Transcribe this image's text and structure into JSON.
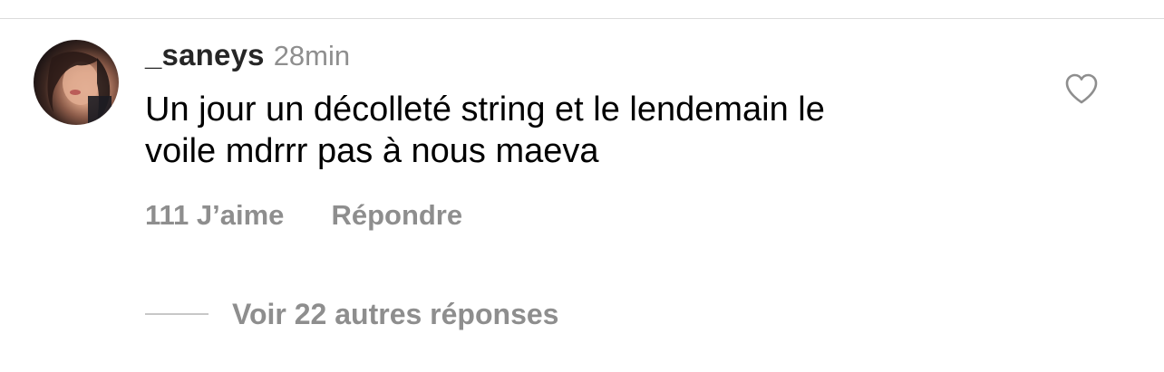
{
  "comment": {
    "username": "_saneys",
    "timestamp": "28min",
    "text_line1": "Un jour un décolleté string et le lendemain le",
    "text_line2": "voile mdrrr pas à nous maeva",
    "likes": "111 J’aime",
    "reply_label": "Répondre",
    "like_icon": "heart-outline-icon"
  },
  "replies": {
    "view_label": "Voir 22 autres réponses"
  },
  "colors": {
    "secondary_text": "#8e8e8e",
    "primary_text": "#000000",
    "divider": "#dbdbdb"
  }
}
